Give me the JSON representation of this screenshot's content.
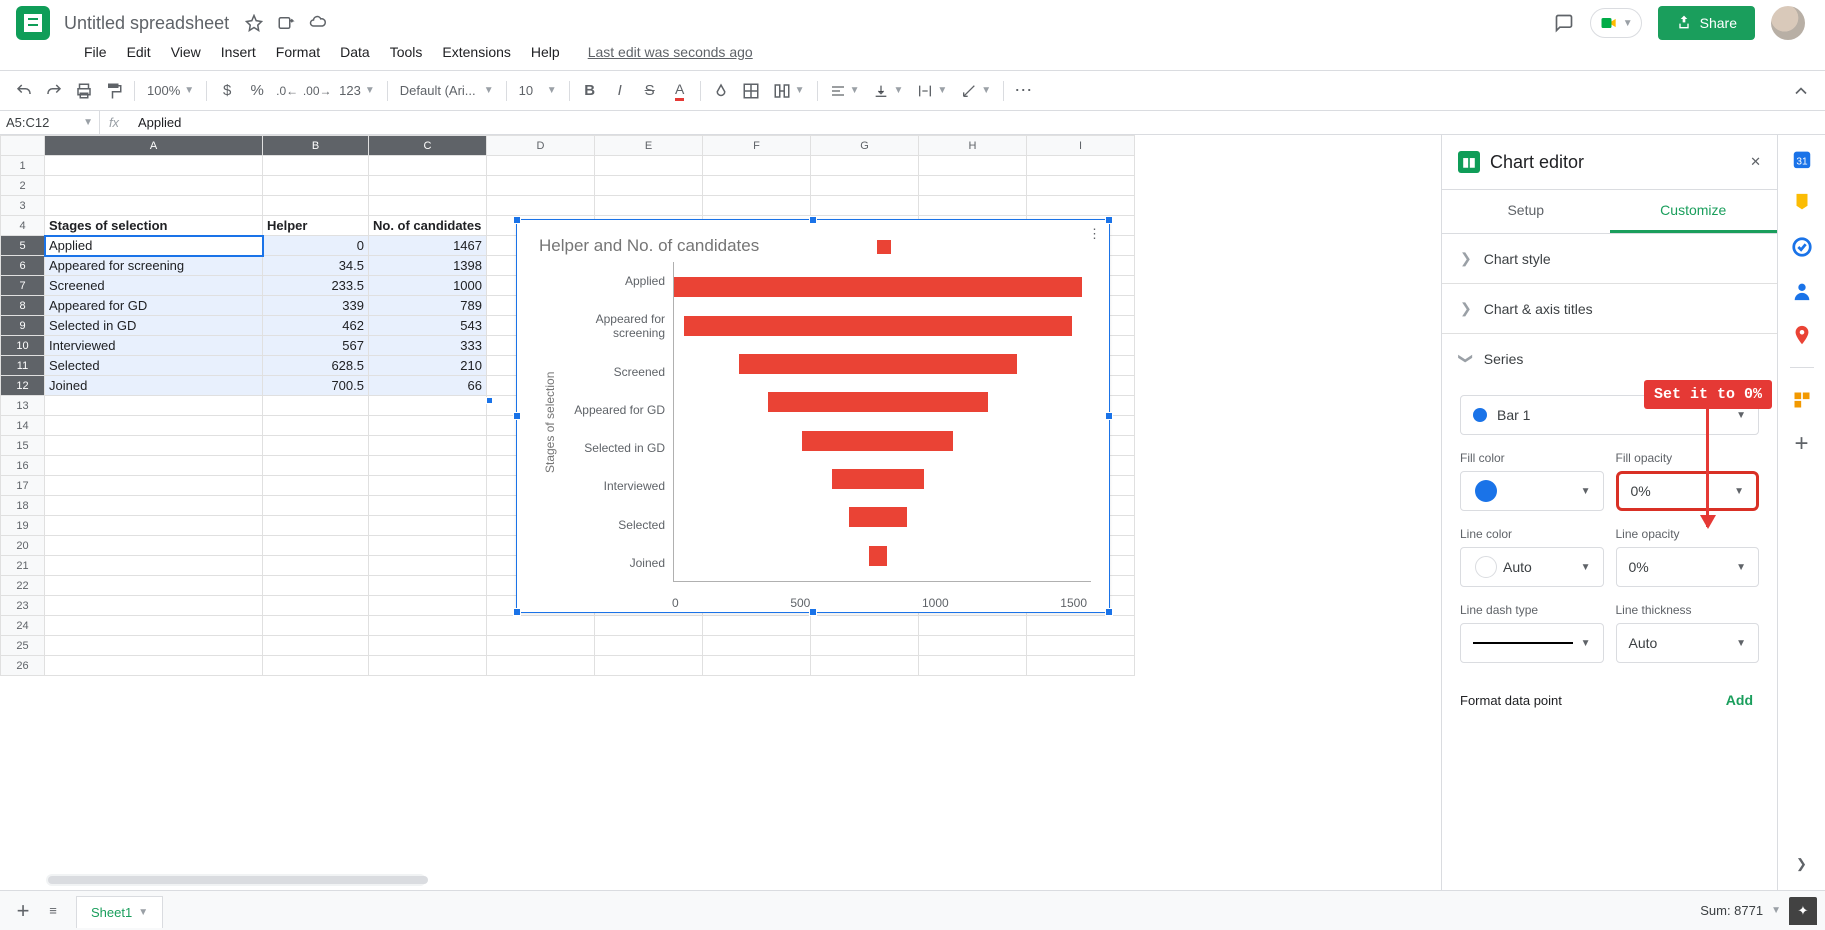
{
  "app": {
    "title": "Untitled spreadsheet",
    "last_edit": "Last edit was seconds ago"
  },
  "menu": {
    "file": "File",
    "edit": "Edit",
    "view": "View",
    "insert": "Insert",
    "format": "Format",
    "data": "Data",
    "tools": "Tools",
    "extensions": "Extensions",
    "help": "Help"
  },
  "toolbar": {
    "zoom": "100%",
    "font": "Default (Ari...",
    "size": "10",
    "number": "123"
  },
  "share_label": "Share",
  "namebox": "A5:C12",
  "fx_value": "Applied",
  "columns": [
    "",
    "A",
    "B",
    "C",
    "D",
    "E",
    "F",
    "G",
    "H",
    "I"
  ],
  "data_headers": {
    "a": "Stages of selection",
    "b": "Helper",
    "c": "No. of candidates"
  },
  "data_rows": [
    {
      "a": "Applied",
      "b": "0",
      "c": "1467"
    },
    {
      "a": "Appeared for screening",
      "b": "34.5",
      "c": "1398"
    },
    {
      "a": "Screened",
      "b": "233.5",
      "c": "1000"
    },
    {
      "a": "Appeared for GD",
      "b": "339",
      "c": "789"
    },
    {
      "a": "Selected in GD",
      "b": "462",
      "c": "543"
    },
    {
      "a": "Interviewed",
      "b": "567",
      "c": "333"
    },
    {
      "a": "Selected",
      "b": "628.5",
      "c": "210"
    },
    {
      "a": "Joined",
      "b": "700.5",
      "c": "66"
    }
  ],
  "chart_data": {
    "type": "bar",
    "orientation": "horizontal",
    "title": "Helper and No. of candidates",
    "ylabel": "Stages of selection",
    "categories": [
      "Applied",
      "Appeared for screening",
      "Screened",
      "Appeared for GD",
      "Selected in GD",
      "Interviewed",
      "Selected",
      "Joined"
    ],
    "series": [
      {
        "name": "Helper",
        "color": "#ea4335",
        "values": [
          0,
          34.5,
          233.5,
          339,
          462,
          567,
          628.5,
          700.5
        ],
        "opacity": 0
      },
      {
        "name": "No. of candidates",
        "color": "#ea4335",
        "values": [
          1467,
          1398,
          1000,
          789,
          543,
          333,
          210,
          66
        ]
      }
    ],
    "x_ticks": [
      "0",
      "500",
      "1000",
      "1500"
    ],
    "x_range": [
      0,
      1500
    ]
  },
  "editor": {
    "title": "Chart editor",
    "tabs": {
      "setup": "Setup",
      "customize": "Customize"
    },
    "sections": {
      "chart_style": "Chart style",
      "axis_titles": "Chart & axis titles",
      "series": "Series"
    },
    "series_select": "Bar 1",
    "fill_color_label": "Fill color",
    "fill_color": "#1a73e8",
    "fill_opacity_label": "Fill opacity",
    "fill_opacity": "0%",
    "line_color_label": "Line color",
    "line_color": "Auto",
    "line_opacity_label": "Line opacity",
    "line_opacity": "0%",
    "line_dash_label": "Line dash type",
    "line_thickness_label": "Line thickness",
    "line_thickness": "Auto",
    "format_point": "Format data point",
    "add": "Add"
  },
  "annotation": "Set it to 0%",
  "sheet_tab": "Sheet1",
  "status": {
    "sum": "Sum: 8771"
  }
}
